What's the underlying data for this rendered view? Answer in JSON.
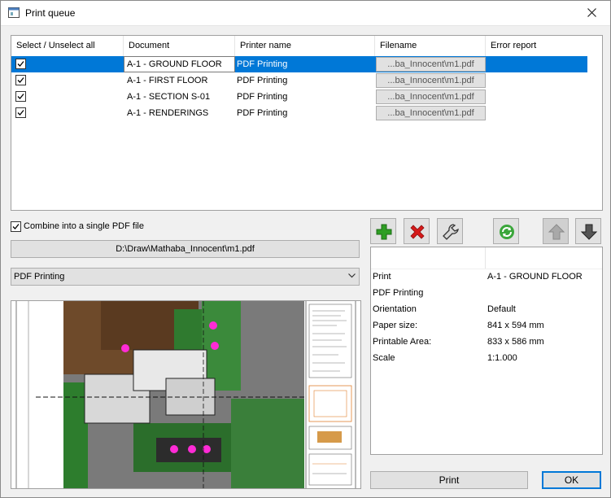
{
  "window": {
    "title": "Print queue"
  },
  "queue": {
    "headers": [
      "Select / Unselect all",
      "Document",
      "Printer name",
      "Filename",
      "Error report"
    ],
    "rows": [
      {
        "checked": true,
        "document": "A-1 - GROUND FLOOR",
        "printer": "PDF Printing",
        "filename": "...ba_Innocent\\m1.pdf",
        "error": "",
        "selected": true
      },
      {
        "checked": true,
        "document": "A-1 - FIRST FLOOR",
        "printer": "PDF Printing",
        "filename": "...ba_Innocent\\m1.pdf",
        "error": "",
        "selected": false
      },
      {
        "checked": true,
        "document": "A-1 - SECTION S-01",
        "printer": "PDF Printing",
        "filename": "...ba_Innocent\\m1.pdf",
        "error": "",
        "selected": false
      },
      {
        "checked": true,
        "document": "A-1 - RENDERINGS",
        "printer": "PDF Printing",
        "filename": "...ba_Innocent\\m1.pdf",
        "error": "",
        "selected": false
      }
    ]
  },
  "combine": {
    "checked": true,
    "label": "Combine into a single PDF file"
  },
  "output_path": "D:\\Draw\\Mathaba_Innocent\\m1.pdf",
  "printer_select": {
    "value": "PDF Printing"
  },
  "toolbar": {
    "buttons": [
      {
        "icon": "add-icon",
        "enabled": true
      },
      {
        "icon": "delete-icon",
        "enabled": true
      },
      {
        "icon": "wrench-icon",
        "enabled": true
      },
      {
        "icon": "refresh-icon",
        "enabled": true
      },
      {
        "icon": "arrow-up-icon",
        "enabled": false
      },
      {
        "icon": "arrow-down-icon",
        "enabled": true
      }
    ]
  },
  "properties": {
    "rows": [
      {
        "key": "Print",
        "value": "A-1 - GROUND FLOOR"
      },
      {
        "key": "PDF Printing",
        "value": ""
      },
      {
        "key": "Orientation",
        "value": "Default"
      },
      {
        "key": "Paper size:",
        "value": "841 x 594 mm"
      },
      {
        "key": "Printable Area:",
        "value": "833 x 586 mm"
      },
      {
        "key": "Scale",
        "value": "1:1.000"
      }
    ]
  },
  "buttons": {
    "print": "Print",
    "ok": "OK"
  },
  "colors": {
    "selection": "#0078d7",
    "add": "#2e9e24",
    "delete": "#d61a1a",
    "refresh": "#3aa63a"
  }
}
